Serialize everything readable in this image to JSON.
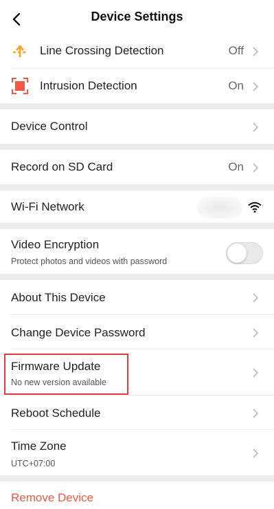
{
  "header": {
    "title": "Device Settings"
  },
  "detections": [
    {
      "label": "Line Crossing Detection",
      "value": "Off",
      "icon": "line-crossing-icon"
    },
    {
      "label": "Intrusion Detection",
      "value": "On",
      "icon": "intrusion-icon"
    }
  ],
  "device_control": {
    "label": "Device Control"
  },
  "record": {
    "label": "Record on SD Card",
    "value": "On"
  },
  "wifi": {
    "label": "Wi-Fi Network",
    "icon": "wifi-icon"
  },
  "encryption": {
    "label": "Video Encryption",
    "sub": "Protect photos and videos with password",
    "enabled": false
  },
  "about": {
    "label": "About This Device"
  },
  "change_password": {
    "label": "Change Device Password"
  },
  "firmware": {
    "label": "Firmware Update",
    "sub": "No new version available"
  },
  "reboot": {
    "label": "Reboot Schedule"
  },
  "timezone": {
    "label": "Time Zone",
    "sub": "UTC+07:00"
  },
  "remove": {
    "label": "Remove Device"
  },
  "colors": {
    "accent_orange": "#f5a623",
    "intrusion_red": "#f05a45",
    "highlight_red": "#e03b42",
    "remove_text": "#f05a45"
  }
}
